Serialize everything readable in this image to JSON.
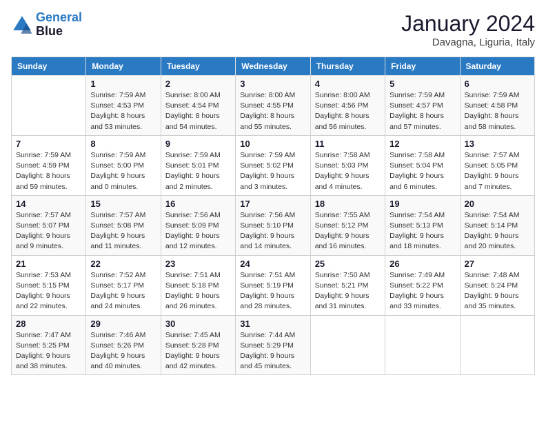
{
  "header": {
    "logo_line1": "General",
    "logo_line2": "Blue",
    "month_year": "January 2024",
    "location": "Davagna, Liguria, Italy"
  },
  "days_of_week": [
    "Sunday",
    "Monday",
    "Tuesday",
    "Wednesday",
    "Thursday",
    "Friday",
    "Saturday"
  ],
  "weeks": [
    [
      {
        "day": "",
        "info": ""
      },
      {
        "day": "1",
        "info": "Sunrise: 7:59 AM\nSunset: 4:53 PM\nDaylight: 8 hours\nand 53 minutes."
      },
      {
        "day": "2",
        "info": "Sunrise: 8:00 AM\nSunset: 4:54 PM\nDaylight: 8 hours\nand 54 minutes."
      },
      {
        "day": "3",
        "info": "Sunrise: 8:00 AM\nSunset: 4:55 PM\nDaylight: 8 hours\nand 55 minutes."
      },
      {
        "day": "4",
        "info": "Sunrise: 8:00 AM\nSunset: 4:56 PM\nDaylight: 8 hours\nand 56 minutes."
      },
      {
        "day": "5",
        "info": "Sunrise: 7:59 AM\nSunset: 4:57 PM\nDaylight: 8 hours\nand 57 minutes."
      },
      {
        "day": "6",
        "info": "Sunrise: 7:59 AM\nSunset: 4:58 PM\nDaylight: 8 hours\nand 58 minutes."
      }
    ],
    [
      {
        "day": "7",
        "info": "Sunrise: 7:59 AM\nSunset: 4:59 PM\nDaylight: 8 hours\nand 59 minutes."
      },
      {
        "day": "8",
        "info": "Sunrise: 7:59 AM\nSunset: 5:00 PM\nDaylight: 9 hours\nand 0 minutes."
      },
      {
        "day": "9",
        "info": "Sunrise: 7:59 AM\nSunset: 5:01 PM\nDaylight: 9 hours\nand 2 minutes."
      },
      {
        "day": "10",
        "info": "Sunrise: 7:59 AM\nSunset: 5:02 PM\nDaylight: 9 hours\nand 3 minutes."
      },
      {
        "day": "11",
        "info": "Sunrise: 7:58 AM\nSunset: 5:03 PM\nDaylight: 9 hours\nand 4 minutes."
      },
      {
        "day": "12",
        "info": "Sunrise: 7:58 AM\nSunset: 5:04 PM\nDaylight: 9 hours\nand 6 minutes."
      },
      {
        "day": "13",
        "info": "Sunrise: 7:57 AM\nSunset: 5:05 PM\nDaylight: 9 hours\nand 7 minutes."
      }
    ],
    [
      {
        "day": "14",
        "info": "Sunrise: 7:57 AM\nSunset: 5:07 PM\nDaylight: 9 hours\nand 9 minutes."
      },
      {
        "day": "15",
        "info": "Sunrise: 7:57 AM\nSunset: 5:08 PM\nDaylight: 9 hours\nand 11 minutes."
      },
      {
        "day": "16",
        "info": "Sunrise: 7:56 AM\nSunset: 5:09 PM\nDaylight: 9 hours\nand 12 minutes."
      },
      {
        "day": "17",
        "info": "Sunrise: 7:56 AM\nSunset: 5:10 PM\nDaylight: 9 hours\nand 14 minutes."
      },
      {
        "day": "18",
        "info": "Sunrise: 7:55 AM\nSunset: 5:12 PM\nDaylight: 9 hours\nand 16 minutes."
      },
      {
        "day": "19",
        "info": "Sunrise: 7:54 AM\nSunset: 5:13 PM\nDaylight: 9 hours\nand 18 minutes."
      },
      {
        "day": "20",
        "info": "Sunrise: 7:54 AM\nSunset: 5:14 PM\nDaylight: 9 hours\nand 20 minutes."
      }
    ],
    [
      {
        "day": "21",
        "info": "Sunrise: 7:53 AM\nSunset: 5:15 PM\nDaylight: 9 hours\nand 22 minutes."
      },
      {
        "day": "22",
        "info": "Sunrise: 7:52 AM\nSunset: 5:17 PM\nDaylight: 9 hours\nand 24 minutes."
      },
      {
        "day": "23",
        "info": "Sunrise: 7:51 AM\nSunset: 5:18 PM\nDaylight: 9 hours\nand 26 minutes."
      },
      {
        "day": "24",
        "info": "Sunrise: 7:51 AM\nSunset: 5:19 PM\nDaylight: 9 hours\nand 28 minutes."
      },
      {
        "day": "25",
        "info": "Sunrise: 7:50 AM\nSunset: 5:21 PM\nDaylight: 9 hours\nand 31 minutes."
      },
      {
        "day": "26",
        "info": "Sunrise: 7:49 AM\nSunset: 5:22 PM\nDaylight: 9 hours\nand 33 minutes."
      },
      {
        "day": "27",
        "info": "Sunrise: 7:48 AM\nSunset: 5:24 PM\nDaylight: 9 hours\nand 35 minutes."
      }
    ],
    [
      {
        "day": "28",
        "info": "Sunrise: 7:47 AM\nSunset: 5:25 PM\nDaylight: 9 hours\nand 38 minutes."
      },
      {
        "day": "29",
        "info": "Sunrise: 7:46 AM\nSunset: 5:26 PM\nDaylight: 9 hours\nand 40 minutes."
      },
      {
        "day": "30",
        "info": "Sunrise: 7:45 AM\nSunset: 5:28 PM\nDaylight: 9 hours\nand 42 minutes."
      },
      {
        "day": "31",
        "info": "Sunrise: 7:44 AM\nSunset: 5:29 PM\nDaylight: 9 hours\nand 45 minutes."
      },
      {
        "day": "",
        "info": ""
      },
      {
        "day": "",
        "info": ""
      },
      {
        "day": "",
        "info": ""
      }
    ]
  ]
}
